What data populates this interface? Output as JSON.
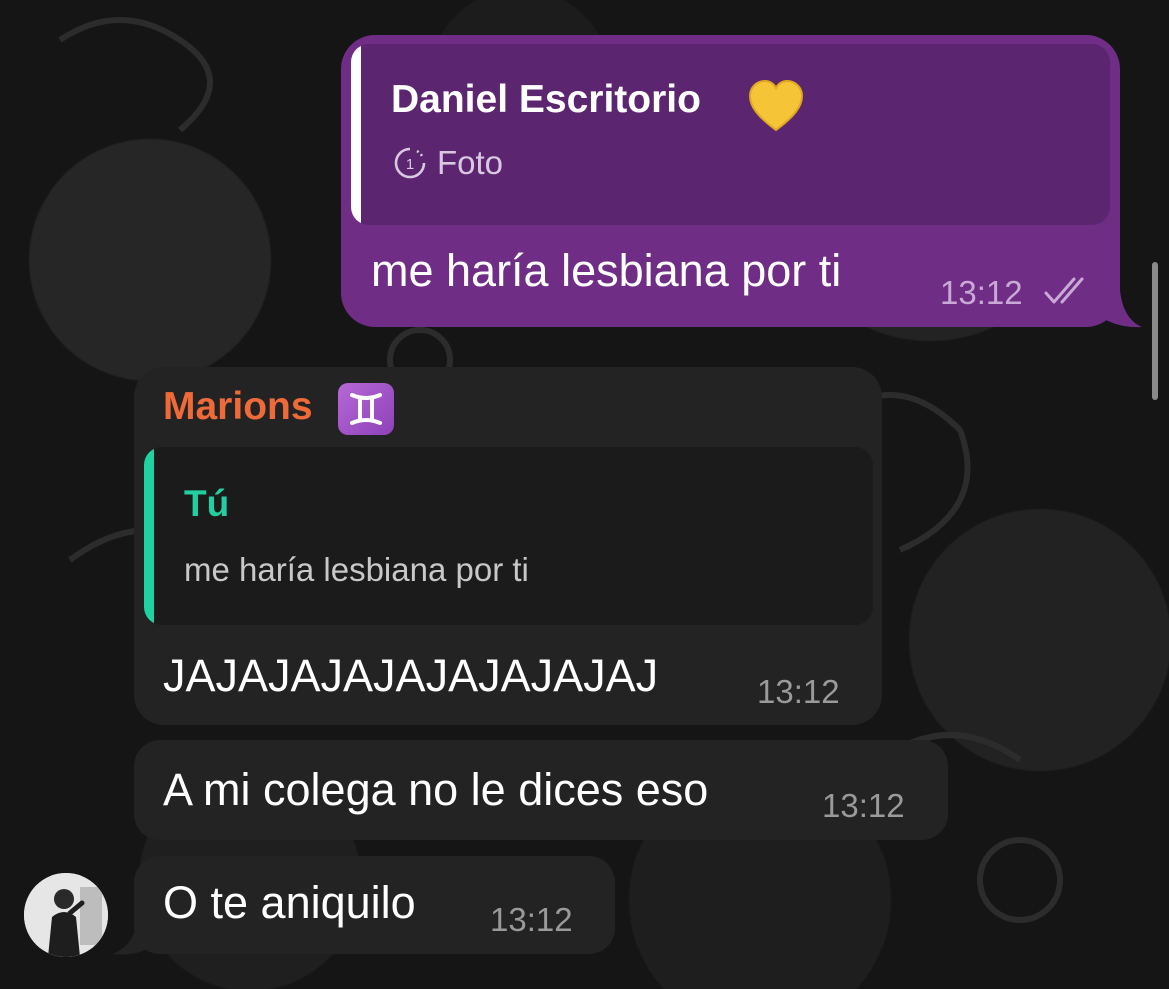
{
  "chat": {
    "outgoing": {
      "reply": {
        "sender": "Daniel Escritorio",
        "media_label": "Foto",
        "icon": "view-once-timer-icon"
      },
      "text": "me haría lesbiana por ti",
      "time": "13:12",
      "status_icon": "double-check-icon",
      "colors": {
        "bubble": "#6f2d86",
        "reply_bg": "#5b2570",
        "reply_bar": "#ffffff"
      }
    },
    "incoming": [
      {
        "sender": "Marions",
        "sender_color": "#ee6a38",
        "reply": {
          "sender": "Tú",
          "text": "me haría lesbiana por ti",
          "bar_color": "#1fd2a0"
        },
        "text": "JAJAJAJAJAJAJAJAJAJ",
        "time": "13:12"
      },
      {
        "text": "A mi colega no le dices eso",
        "time": "13:12"
      },
      {
        "text": "O te aniquilo",
        "time": "13:12",
        "avatar": "contact-avatar"
      }
    ]
  }
}
